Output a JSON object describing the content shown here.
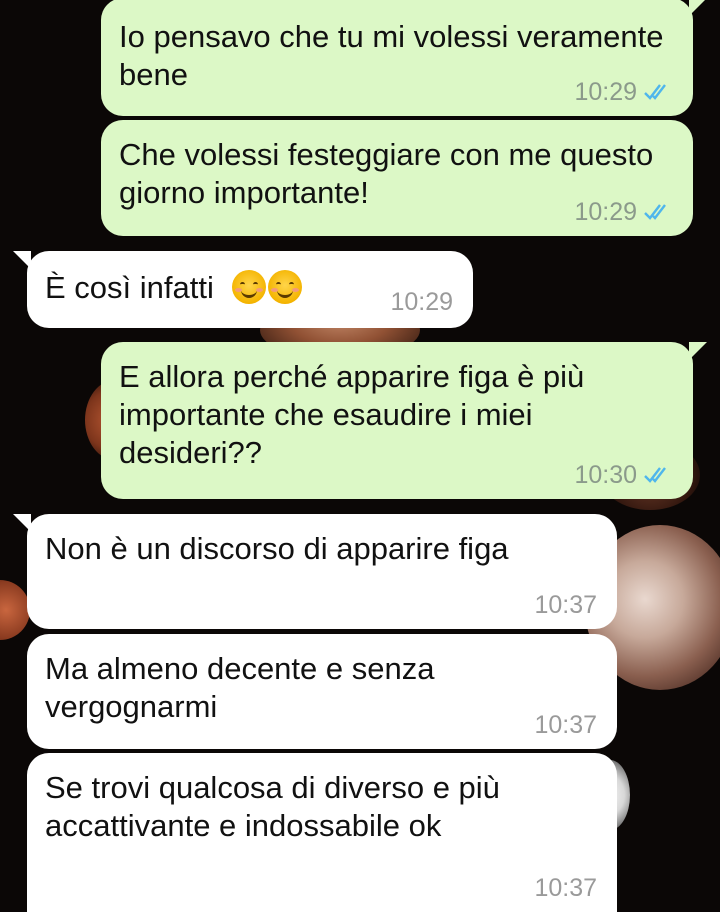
{
  "colors": {
    "outgoing_bubble": "#dcf8c6",
    "incoming_bubble": "#ffffff",
    "read_ticks": "#4fb6ec",
    "background": "#0b0706"
  },
  "messages": [
    {
      "direction": "out",
      "text": "Io pensavo che tu mi volessi veramente bene",
      "time": "10:29",
      "status": "read-ticks-icon"
    },
    {
      "direction": "out",
      "text": "Che volessi festeggiare con me questo giorno importante!",
      "time": "10:29",
      "status": "read-ticks-icon"
    },
    {
      "direction": "in",
      "text": "È così infatti",
      "emoji": [
        "smiling-face-icon",
        "smiling-face-icon"
      ],
      "time": "10:29"
    },
    {
      "direction": "out",
      "text": "E allora perché apparire figa è più importante che esaudire i miei desideri??",
      "time": "10:30",
      "status": "read-ticks-icon"
    },
    {
      "direction": "in",
      "text": "Non è un discorso di apparire figa",
      "time": "10:37"
    },
    {
      "direction": "in",
      "text": "Ma almeno decente e senza vergognarmi",
      "time": "10:37"
    },
    {
      "direction": "in",
      "text": "Se trovi qualcosa di diverso e più accattivante e indossabile ok",
      "time": "10:37"
    }
  ]
}
